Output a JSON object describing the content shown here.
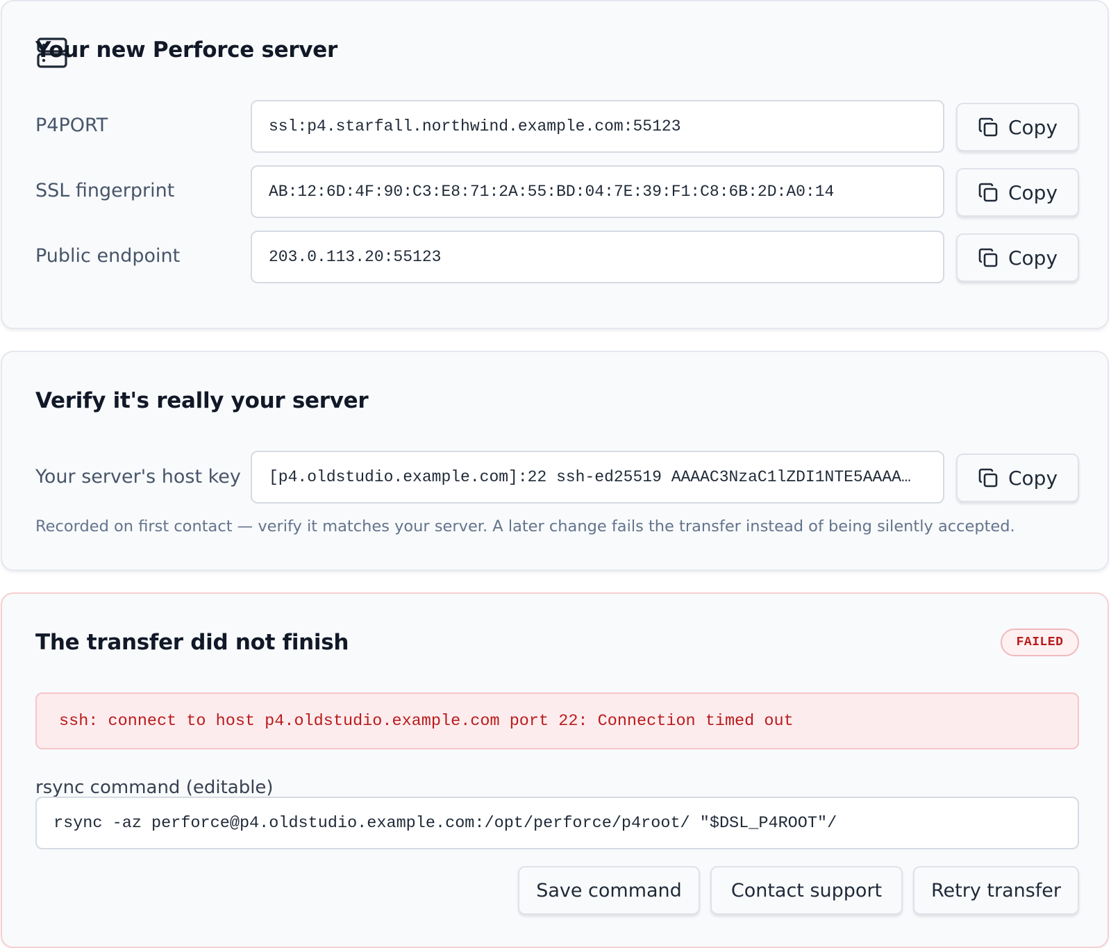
{
  "server_card": {
    "title": "Your new Perforce server",
    "icon": "server-icon",
    "rows": [
      {
        "label": "P4PORT",
        "value": "ssl:p4.starfall.northwind.example.com:55123",
        "copy_label": "Copy"
      },
      {
        "label": "SSL fingerprint",
        "value": "AB:12:6D:4F:90:C3:E8:71:2A:55:BD:04:7E:39:F1:C8:6B:2D:A0:14",
        "copy_label": "Copy"
      },
      {
        "label": "Public endpoint",
        "value": "203.0.113.20:55123",
        "copy_label": "Copy"
      }
    ]
  },
  "verify_card": {
    "title": "Verify it's really your server",
    "host_key": {
      "label": "Your server's host key",
      "value": "[p4.oldstudio.example.com]:22 ssh-ed25519 AAAAC3NzaC1lZDI1NTE5AAAA…",
      "copy_label": "Copy"
    },
    "hint": "Recorded on first contact — verify it matches your server. A later change fails the transfer instead of being silently accepted."
  },
  "transfer_card": {
    "title": "The transfer did not finish",
    "status_badge": "FAILED",
    "error_message": "ssh: connect to host p4.oldstudio.example.com port 22: Connection timed out",
    "command_label": "rsync command (editable)",
    "command_value": "rsync -az perforce@p4.oldstudio.example.com:/opt/perforce/p4root/ \"$DSL_P4ROOT\"/",
    "buttons": {
      "save": "Save command",
      "support": "Contact support",
      "retry": "Retry transfer"
    }
  },
  "colors": {
    "failed": "#b91c1c",
    "error_bg": "#fdecee",
    "card_bg": "#f8fafc"
  }
}
